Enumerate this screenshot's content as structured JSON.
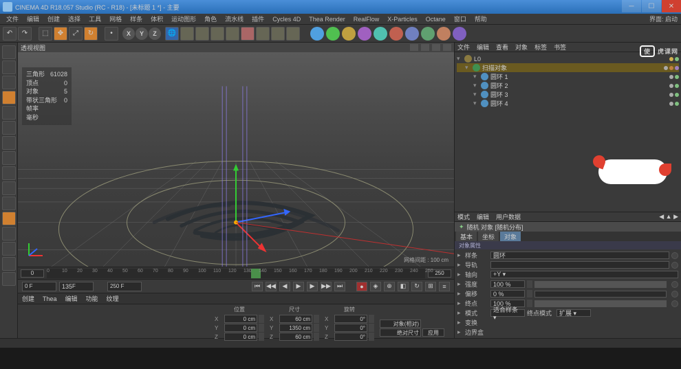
{
  "title": "CINEMA 4D R18.057 Studio (RC - R18) - [未标题 1 *] - 主要",
  "menu": [
    "文件",
    "编辑",
    "创建",
    "选择",
    "工具",
    "网格",
    "样条",
    "体积",
    "运动图形",
    "角色",
    "流水线",
    "插件",
    "Cycles 4D",
    "Thea Render",
    "RealFlow",
    "X-Particles",
    "Octane",
    "窗口",
    "帮助"
  ],
  "menu_right": "界面: 启动",
  "axes": [
    "X",
    "Y",
    "Z"
  ],
  "viewportLabel": "透视视图",
  "hud": {
    "三角形": "61028",
    "顶点": "0",
    "对象": "5",
    "带状三角形": "0",
    "帧率": "",
    "毫秒": ""
  },
  "viewportFooter": "网格间距 : 100 cm",
  "timeline": {
    "start": 0,
    "end": 250,
    "current": 135,
    "startField": "0 F",
    "endField": "250 F"
  },
  "matTabs": [
    "创建",
    "Thea",
    "编辑",
    "功能",
    "纹理"
  ],
  "coord": {
    "hdrs": [
      "位置",
      "尺寸",
      "旋转"
    ],
    "rows": [
      {
        "l": "X",
        "p": "0 cm",
        "s": "60 cm",
        "r": "0°"
      },
      {
        "l": "Y",
        "p": "0 cm",
        "s": "1350 cm",
        "r": "0°"
      },
      {
        "l": "Z",
        "p": "0 cm",
        "s": "60 cm",
        "r": "0°"
      }
    ],
    "modeL": "对象(相对)",
    "modeR": "绝对尺寸",
    "apply": "应用"
  },
  "objmgr": {
    "menu": [
      "文件",
      "编辑",
      "查看",
      "对象",
      "标签",
      "书签"
    ],
    "rows": [
      {
        "indent": 0,
        "name": "L0",
        "ic": "#8a7a40",
        "tags": [
          "#d0b050",
          "#80c080"
        ]
      },
      {
        "indent": 1,
        "name": "扫描对象",
        "ic": "#409050",
        "sel": true,
        "tags": [
          "#aaa",
          "#c08040",
          "#a080c0"
        ]
      },
      {
        "indent": 2,
        "name": "圆环 1",
        "ic": "#5090c0",
        "tags": [
          "#aaa",
          "#80c080"
        ]
      },
      {
        "indent": 2,
        "name": "圆环 2",
        "ic": "#5090c0",
        "tags": [
          "#aaa",
          "#80c080"
        ]
      },
      {
        "indent": 2,
        "name": "圆环 3",
        "ic": "#5090c0",
        "tags": [
          "#aaa",
          "#80c080"
        ]
      },
      {
        "indent": 2,
        "name": "圆环 4",
        "ic": "#5090c0",
        "tags": [
          "#aaa",
          "#80c080"
        ]
      }
    ]
  },
  "attr": {
    "menu": [
      "模式",
      "编辑",
      "用户数据"
    ],
    "title": "随机 对象 [随机分布]",
    "tabs": [
      "基本",
      "坐标",
      "对象"
    ],
    "section": "对象属性",
    "rows": [
      {
        "k": "样条",
        "v": "圆环",
        "type": "link"
      },
      {
        "k": "导轨",
        "v": "",
        "type": "link"
      },
      {
        "k": "轴向",
        "v": "+Y",
        "type": "sel"
      },
      {
        "k": "强度",
        "v": "100 %",
        "type": "slider",
        "pct": 100
      },
      {
        "k": "偏移",
        "v": "0 %",
        "type": "slider",
        "pct": 0
      },
      {
        "k": "终点",
        "v": "100 %",
        "type": "slider",
        "pct": 100
      }
    ],
    "moderow": {
      "k": "模式",
      "a": "适合样条",
      "b": "终点模式",
      "c": "扩展"
    },
    "extra": [
      "变换",
      "边界盒"
    ]
  },
  "watermark": "虎课网"
}
